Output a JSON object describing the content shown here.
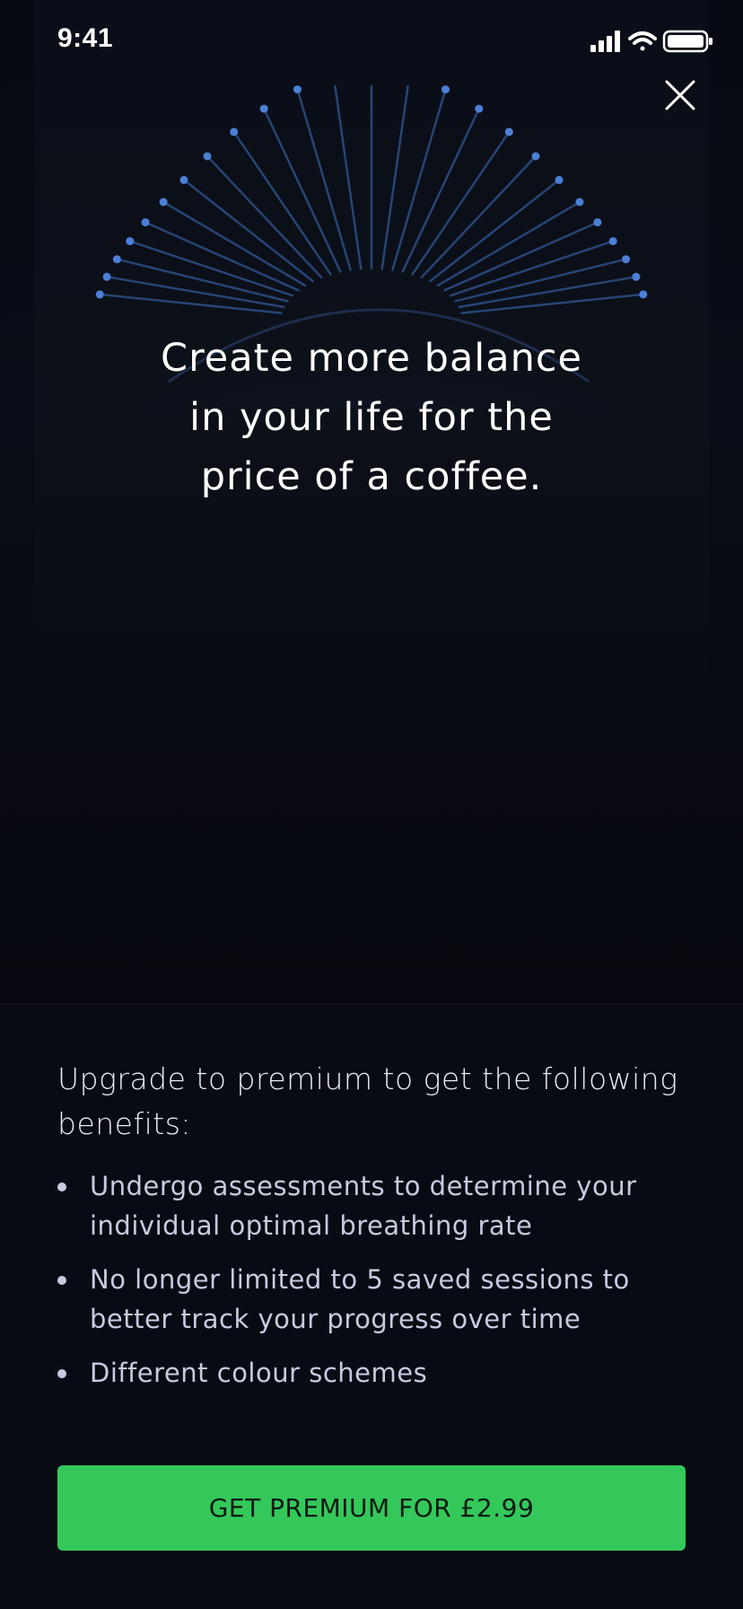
{
  "status_bar": {
    "time": "9:41"
  },
  "icons": {
    "signal": "cellular-signal-icon",
    "wifi": "wifi-icon",
    "battery": "battery-icon",
    "close": "close-icon",
    "hero_art": "breathing-wave-illustration"
  },
  "hero": {
    "headline_line1": "Create more balance",
    "headline_line2": "in your life for the",
    "headline_line3": "price of a coffee."
  },
  "benefits": {
    "intro": "Upgrade to premium to get the following benefits:",
    "items": [
      {
        "text": "Undergo assessments to determine your individual optimal breathing rate"
      },
      {
        "text": "No longer limited to 5 saved sessions to better track your progress over time"
      },
      {
        "text": "Different colour schemes"
      }
    ]
  },
  "cta": {
    "label": "GET PREMIUM FOR £2.99"
  },
  "colors": {
    "background": "#090a10",
    "accent_green": "#34c85a",
    "art_blue": "#4c7fd6"
  }
}
